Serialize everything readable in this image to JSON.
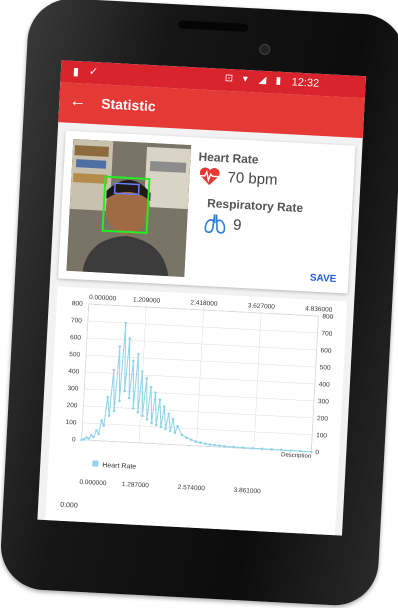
{
  "status": {
    "time": "12:32"
  },
  "appbar": {
    "back_icon": "arrow-left-icon",
    "title": "Statistic"
  },
  "measure": {
    "heart_rate_label": "Heart Rate",
    "heart_rate_value": "70 bpm",
    "respiratory_rate_label": "Respiratory Rate",
    "respiratory_rate_value": "9",
    "save_label": "SAVE"
  },
  "chart_data": {
    "type": "line",
    "title": "",
    "top_x_ticks": [
      "0.000000",
      "1.209000",
      "2.418000",
      "3.627000",
      "4.836000"
    ],
    "y_ticks": [
      "0",
      "100",
      "200",
      "300",
      "400",
      "500",
      "600",
      "700",
      "800"
    ],
    "ylim": [
      0,
      800
    ],
    "xlim": [
      0,
      4.836
    ],
    "description": "Description",
    "legend": [
      "Heart Rate"
    ],
    "series": [
      {
        "name": "Heart Rate",
        "color": "#8fd4ea",
        "x": [
          0.0,
          0.05,
          0.1,
          0.15,
          0.2,
          0.25,
          0.3,
          0.35,
          0.4,
          0.45,
          0.5,
          0.55,
          0.6,
          0.65,
          0.7,
          0.75,
          0.8,
          0.85,
          0.9,
          0.95,
          1.0,
          1.05,
          1.1,
          1.15,
          1.2,
          1.25,
          1.3,
          1.35,
          1.4,
          1.45,
          1.5,
          1.55,
          1.6,
          1.65,
          1.7,
          1.75,
          1.8,
          1.85,
          1.9,
          1.95,
          2.0,
          2.1,
          2.2,
          2.3,
          2.4,
          2.5,
          2.6,
          2.7,
          2.8,
          2.9,
          3.0,
          3.2,
          3.4,
          3.6,
          3.8,
          4.0,
          4.2,
          4.4,
          4.6,
          4.836
        ],
        "y": [
          0,
          5,
          15,
          10,
          30,
          20,
          60,
          40,
          120,
          90,
          260,
          150,
          420,
          180,
          560,
          240,
          700,
          300,
          610,
          260,
          480,
          200,
          520,
          180,
          420,
          160,
          380,
          140,
          330,
          120,
          300,
          110,
          260,
          100,
          220,
          90,
          180,
          80,
          150,
          70,
          110,
          60,
          45,
          35,
          25,
          20,
          15,
          12,
          10,
          8,
          6,
          5,
          4,
          3,
          3,
          2,
          2,
          1,
          1,
          0
        ]
      }
    ],
    "second_x_ticks": [
      "0.000000",
      "1.287000",
      "2.574000",
      "3.861000"
    ],
    "second_y_tick": "0.000"
  },
  "nav": {
    "back": "triangle-back-icon",
    "home": "circle-home-icon",
    "recents": "square-recents-icon"
  }
}
